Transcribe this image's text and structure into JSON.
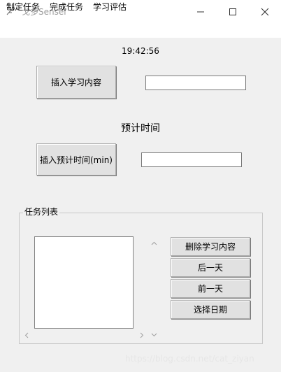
{
  "window": {
    "title": "戈多Sensei",
    "icon": "feather-icon",
    "controls": [
      "minimize-icon",
      "maximize-icon",
      "close-icon"
    ]
  },
  "menu": {
    "items": [
      "制定任务",
      "完成任务",
      "学习评估"
    ]
  },
  "clock": "19:42:56",
  "content": {
    "insert_label": "插入学习内容",
    "entry_value": ""
  },
  "estimate": {
    "label": "预计时间",
    "insert_label": "插入预计时间(min)",
    "entry_value": ""
  },
  "tasks": {
    "group_label": "任务列表",
    "items": []
  },
  "actions": {
    "delete_label": "删除学习内容",
    "next_day_label": "后一天",
    "prev_day_label": "前一天",
    "choose_date_label": "选择日期"
  },
  "watermark": "https://blog.csdn.net/cat_ziyan",
  "colors": {
    "window_bg": "#f0f0f0",
    "button_bg": "#e1e1e1",
    "border": "#adadad",
    "title_text": "#9a9a9a"
  }
}
